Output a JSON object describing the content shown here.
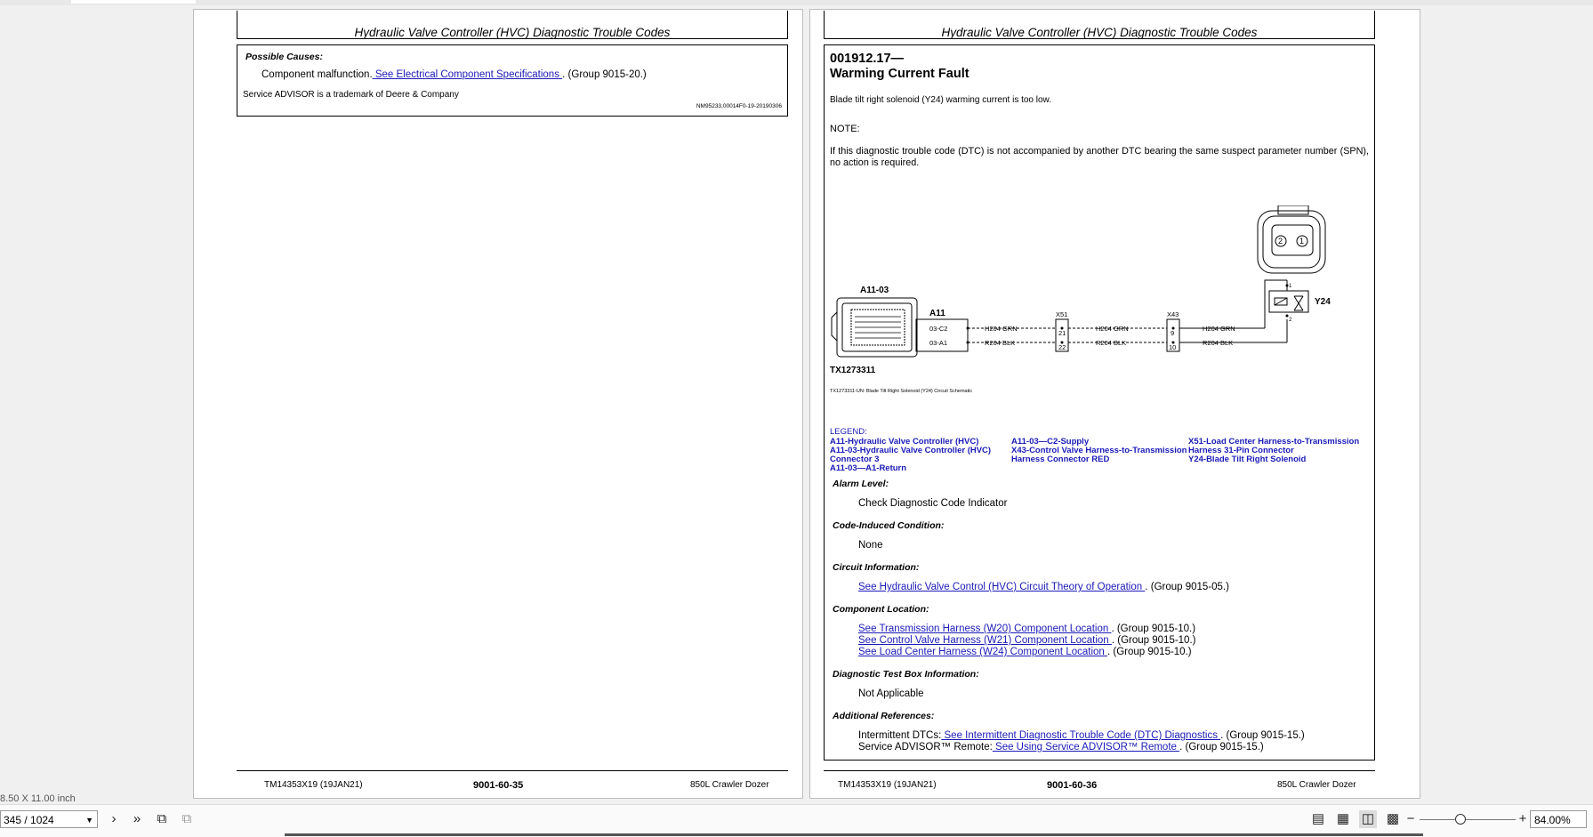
{
  "document": {
    "header_title": "Hydraulic Valve Controller (HVC) Diagnostic Trouble Codes"
  },
  "left_page": {
    "possible_causes_label": "Possible Causes:",
    "cause_text": "Component malfunction.",
    "cause_link": " See Electrical Component Specifications ",
    "cause_group": ". (Group 9015-20.)",
    "trademark": "Service ADVISOR is a trademark of Deere & Company",
    "doc_id": "NM95233,00014F0-19-20190306",
    "footer": {
      "manual": "TM14353X19 (19JAN21)",
      "page": "9001-60-35",
      "machine": "850L Crawler Dozer"
    }
  },
  "right_page": {
    "dtc_code": "001912.17—",
    "dtc_title": "Warming Current Fault",
    "description": "Blade tilt right solenoid (Y24) warming current is too low.",
    "note_label": "NOTE:",
    "note_text": "If this diagnostic trouble code (DTC) is not accompanied by another DTC bearing the same suspect parameter number (SPN), no action is required.",
    "diagram": {
      "connector_a1103": "A11-03",
      "a11": "A11",
      "pin_c2": "03-C2",
      "pin_a1": "03-A1",
      "wire_grn": "H204 GRN",
      "wire_blk": "R204 BLK",
      "x51": "X51",
      "x51_p1": "21",
      "x51_p2": "22",
      "x43": "X43",
      "x43_p1": "9",
      "x43_p2": "10",
      "y24": "Y24",
      "y24_p1": "1",
      "y24_p2": "2",
      "conn_pin2": "2",
      "conn_pin1": "1",
      "fig_id": "TX1273311",
      "caption": "TX1273311-UN: Blade Tilt Right Solenoid (Y24) Circuit Schematic"
    },
    "legend_label": "LEGEND:",
    "legend_col1": [
      "A11-Hydraulic Valve Controller (HVC)",
      "A11-03-Hydraulic Valve Controller (HVC)",
      "Connector 3",
      "A11-03—A1-Return"
    ],
    "legend_col2": [
      "A11-03—C2-Supply",
      "X43-Control Valve Harness-to-Transmission",
      "Harness Connector RED"
    ],
    "legend_col3": [
      "X51-Load Center Harness-to-Transmission",
      "Harness 31-Pin Connector",
      "Y24-Blade Tilt Right Solenoid"
    ],
    "alarm_label": "Alarm Level:",
    "alarm_value": "Check Diagnostic Code Indicator",
    "code_induced_label": "Code-Induced Condition:",
    "code_induced_value": "None",
    "circuit_label": "Circuit Information:",
    "circuit_link": "See Hydraulic Valve Control (HVC) Circuit Theory of Operation ",
    "circuit_group": ". (Group 9015-05.)",
    "component_label": "Component Location:",
    "comp_link1": "See Transmission Harness (W20) Component Location ",
    "comp_group1": ". (Group 9015-10.)",
    "comp_link2": "See Control Valve Harness (W21) Component Location ",
    "comp_group2": ". (Group 9015-10.)",
    "comp_link3": "See Load Center Harness (W24) Component Location ",
    "comp_group3": ". (Group 9015-10.)",
    "test_box_label": "Diagnostic Test Box Information:",
    "test_box_value": "Not Applicable",
    "additional_label": "Additional References:",
    "add1_text": "Intermittent DTCs:",
    "add1_link": " See Intermittent Diagnostic Trouble Code (DTC) Diagnostics ",
    "add1_group": ". (Group 9015-15.)",
    "add2_text": "Service ADVISOR™ Remote:",
    "add2_link": " See Using Service ADVISOR™ Remote ",
    "add2_group": ". (Group 9015-15.)",
    "footer": {
      "manual": "TM14353X19 (19JAN21)",
      "page": "9001-60-36",
      "machine": "850L Crawler Dozer"
    }
  },
  "viewer": {
    "page_size": "8.50 X 11.00 inch",
    "page_indicator": "345 / 1024",
    "zoom": "84.00%"
  }
}
